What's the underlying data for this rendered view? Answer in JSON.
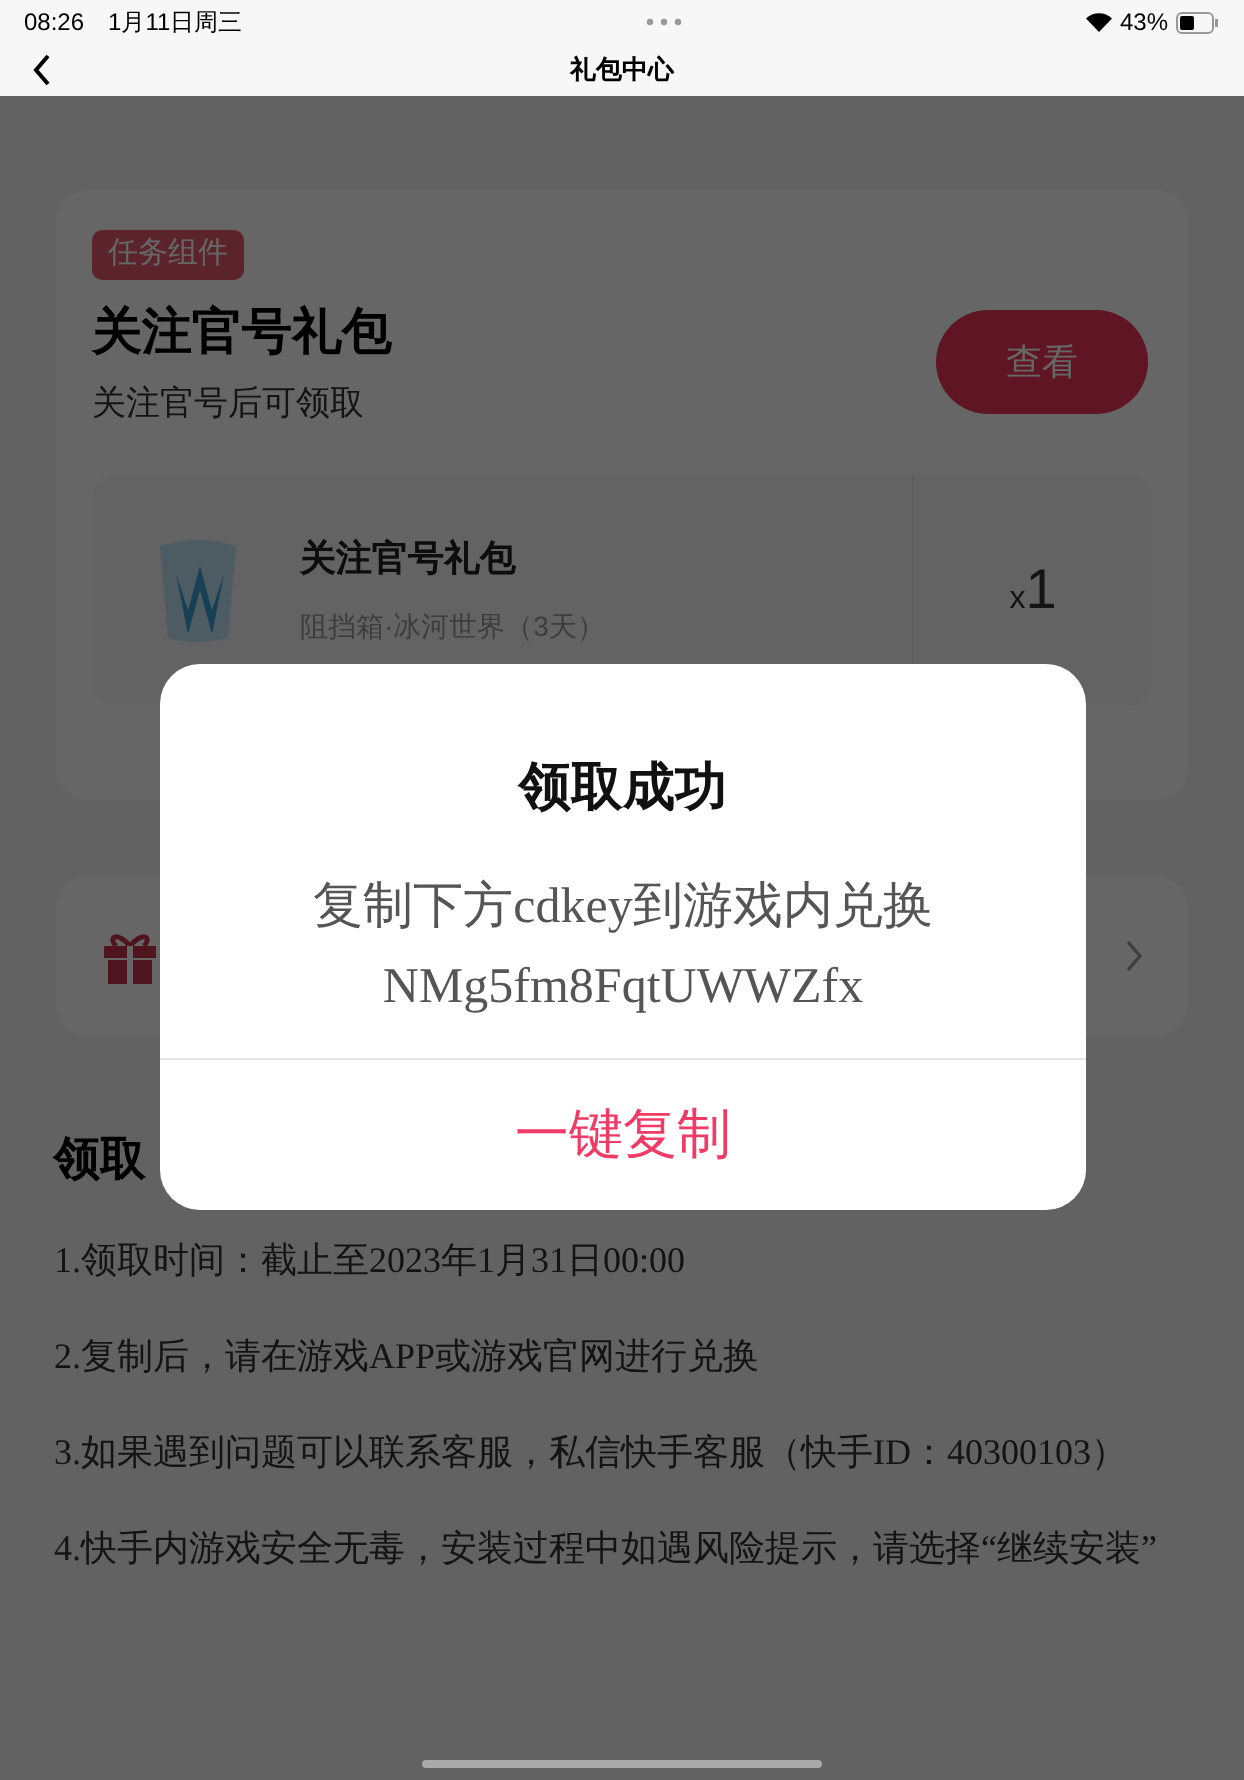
{
  "status_bar": {
    "time": "08:26",
    "date": "1月11日周三",
    "battery": "43%"
  },
  "nav": {
    "title": "礼包中心"
  },
  "task_card": {
    "tag": "任务组件",
    "title": "关注官号礼包",
    "subtitle": "关注官号后可领取",
    "button": "查看",
    "item": {
      "name": "关注官号礼包",
      "description": "阻挡箱·冰河世界（3天）",
      "quantity_prefix": "x",
      "quantity": "1"
    }
  },
  "section": {
    "title": "领取"
  },
  "rules": [
    "1.领取时间：截止至2023年1月31日00:00",
    "2.复制后，请在游戏APP或游戏官网进行兑换",
    "3.如果遇到问题可以联系客服，私信快手客服（快手ID：40300103）",
    "4.快手内游戏安全无毒，安装过程中如遇风险提示，请选择“继续安装”"
  ],
  "dialog": {
    "title": "领取成功",
    "message": "复制下方cdkey到游戏内兑换",
    "code": "NMg5fm8FqtUWWZfx",
    "button": "一键复制"
  }
}
